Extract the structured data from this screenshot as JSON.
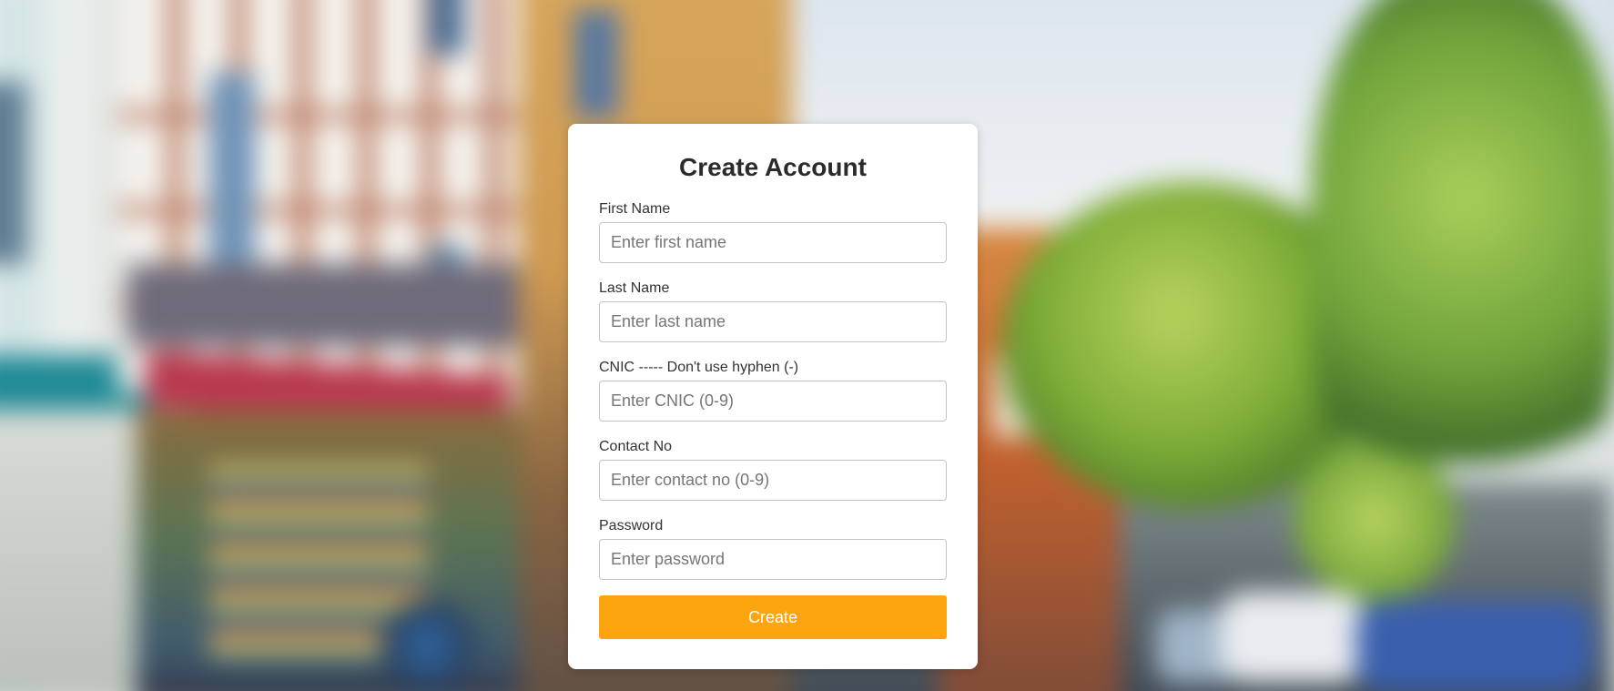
{
  "form": {
    "title": "Create Account",
    "fields": [
      {
        "label": "First Name",
        "placeholder": "Enter first name",
        "value": ""
      },
      {
        "label": "Last Name",
        "placeholder": "Enter last name",
        "value": ""
      },
      {
        "label": "CNIC ----- Don't use hyphen (-)",
        "placeholder": "Enter CNIC (0-9)",
        "value": ""
      },
      {
        "label": "Contact No",
        "placeholder": "Enter contact no (0-9)",
        "value": ""
      },
      {
        "label": "Password",
        "placeholder": "Enter password",
        "value": ""
      }
    ],
    "submit_label": "Create"
  },
  "colors": {
    "accent": "#fda50f",
    "card_background": "#ffffff",
    "title_text": "#2b2b2b"
  }
}
